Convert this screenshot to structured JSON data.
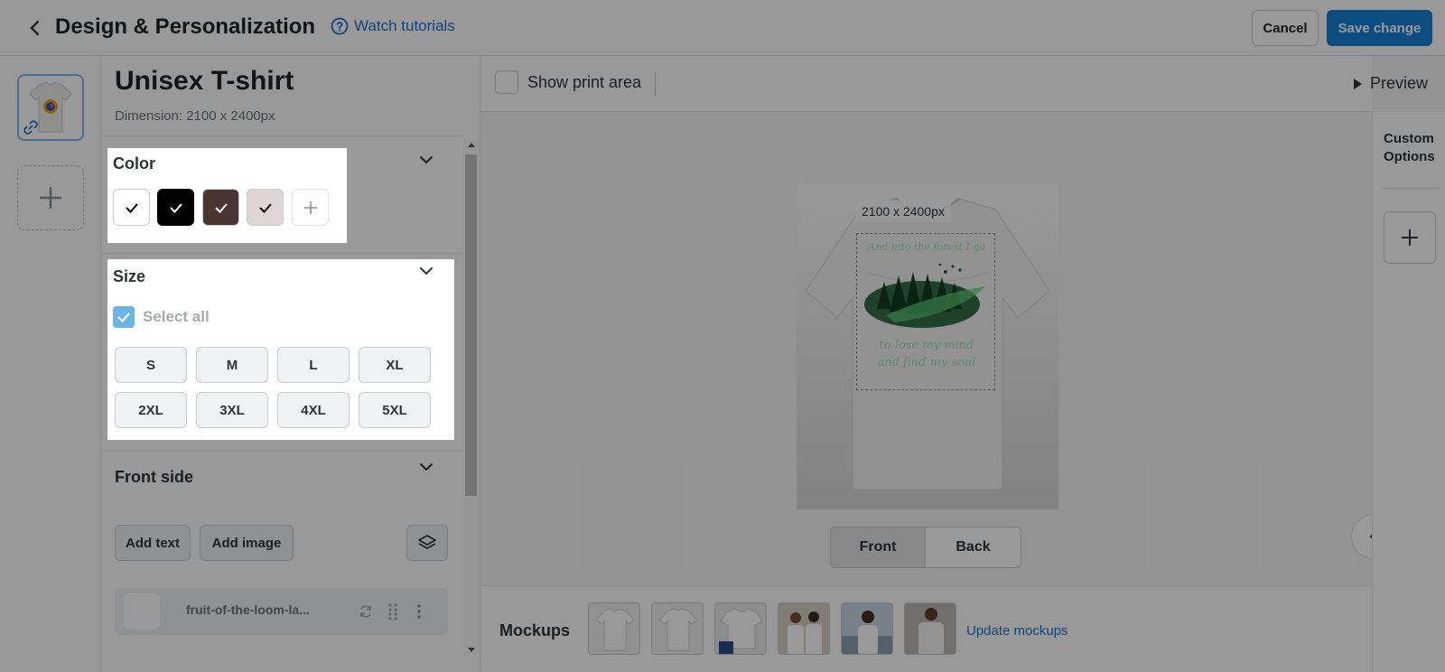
{
  "header": {
    "title": "Design & Personalization",
    "tutorial_label": "Watch tutorials",
    "cancel_label": "Cancel",
    "save_label": "Save change"
  },
  "product": {
    "title": "Unisex T-shirt",
    "dimension": "Dimension: 2100 x 2400px"
  },
  "color_section": {
    "title": "Color",
    "swatches": [
      "#ffffff",
      "#000000",
      "#4a3530",
      "#e0d5d6"
    ]
  },
  "size_section": {
    "title": "Size",
    "select_all_label": "Select all",
    "sizes": [
      "S",
      "M",
      "L",
      "XL",
      "2XL",
      "3XL",
      "4XL",
      "5XL"
    ]
  },
  "front_section": {
    "title": "Front side",
    "add_text_label": "Add text",
    "add_image_label": "Add image",
    "layer_name": "fruit-of-the-loom-la..."
  },
  "canvas": {
    "show_print_area_label": "Show print area",
    "preview_label": "Preview",
    "print_dimension": "2100 x 2400px",
    "design_line1": "And into the forest I go",
    "design_line2": "to lose my mind",
    "design_line3": "and find my soul",
    "front_label": "Front",
    "back_label": "Back"
  },
  "mockups": {
    "label": "Mockups",
    "update_label": "Update mockups"
  },
  "right_panel": {
    "custom_options_line1": "Custom",
    "custom_options_line2": "Options"
  },
  "colors": {
    "accent": "#1481d8",
    "link": "#1a73c8",
    "checkbox": "#6cb3ea"
  }
}
